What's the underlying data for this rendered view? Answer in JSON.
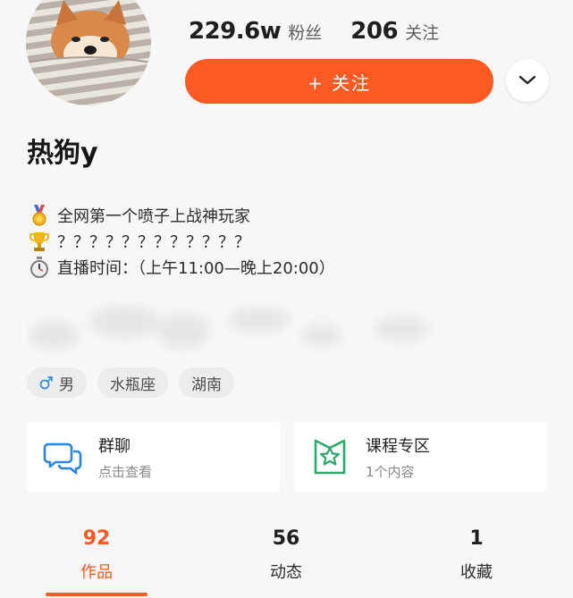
{
  "profile": {
    "username": "热狗y",
    "followers_count": "229.6w",
    "followers_label": "粉丝",
    "following_count": "206",
    "following_label": "关注"
  },
  "actions": {
    "follow_label": "+ 关注"
  },
  "bio": {
    "lines": [
      {
        "icon": "medal-icon",
        "text": "全网第一个喷子上战神玩家"
      },
      {
        "icon": "trophy-icon",
        "text": "？？？？？？？？？？？？"
      },
      {
        "icon": "stopwatch-icon",
        "text": "直播时间：（上午11:00—晚上20:00）"
      }
    ]
  },
  "tags": [
    {
      "icon": "male-icon",
      "label": "男"
    },
    {
      "label": "水瓶座"
    },
    {
      "label": "湖南"
    }
  ],
  "cards": [
    {
      "icon": "chat-bubbles-icon",
      "title": "群聊",
      "subtitle": "点击查看"
    },
    {
      "icon": "course-star-icon",
      "title": "课程专区",
      "subtitle": "1个内容"
    }
  ],
  "tabs": [
    {
      "count": "92",
      "label": "作品",
      "active": true
    },
    {
      "count": "56",
      "label": "动态",
      "active": false
    },
    {
      "count": "1",
      "label": "收藏",
      "active": false
    }
  ],
  "colors": {
    "accent": "#fb5a23",
    "background": "#f7f7f7",
    "card": "#ffffff",
    "male_tag": "#3d8fe0",
    "card_icon_blue": "#2c86e0",
    "card_icon_green": "#2ea86d"
  }
}
